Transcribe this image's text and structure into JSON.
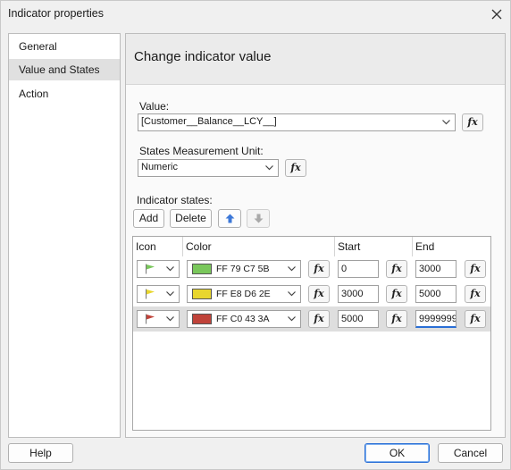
{
  "window": {
    "title": "Indicator properties",
    "close_icon": "close-icon"
  },
  "nav": {
    "items": [
      {
        "label": "General",
        "selected": false
      },
      {
        "label": "Value and States",
        "selected": true
      },
      {
        "label": "Action",
        "selected": false
      }
    ]
  },
  "panel": {
    "title": "Change indicator value",
    "value_label": "Value:",
    "value": "[Customer__Balance__LCY__]",
    "unit_label": "States Measurement Unit:",
    "unit": "Numeric",
    "states_label": "Indicator states:",
    "add_label": "Add",
    "delete_label": "Delete",
    "fx_label": "fx"
  },
  "grid": {
    "headers": [
      "Icon",
      "Color",
      "Start",
      "End"
    ],
    "rows": [
      {
        "flag_color": "#79C75B",
        "color_hex": "#79C75B",
        "color_label": "FF 79 C7 5B",
        "start": "0",
        "end": "3000"
      },
      {
        "flag_color": "#E8D62E",
        "color_hex": "#E8D62E",
        "color_label": "FF E8 D6 2E",
        "start": "3000",
        "end": "5000"
      },
      {
        "flag_color": "#C0433A",
        "color_hex": "#C0433A",
        "color_label": "FF C0 43 3A",
        "start": "5000",
        "end": "9999999"
      }
    ]
  },
  "footer": {
    "help": "Help",
    "ok": "OK",
    "cancel": "Cancel"
  },
  "colors": {
    "accent": "#2A6FD6",
    "move_up_arrow": "#3C78D8"
  }
}
